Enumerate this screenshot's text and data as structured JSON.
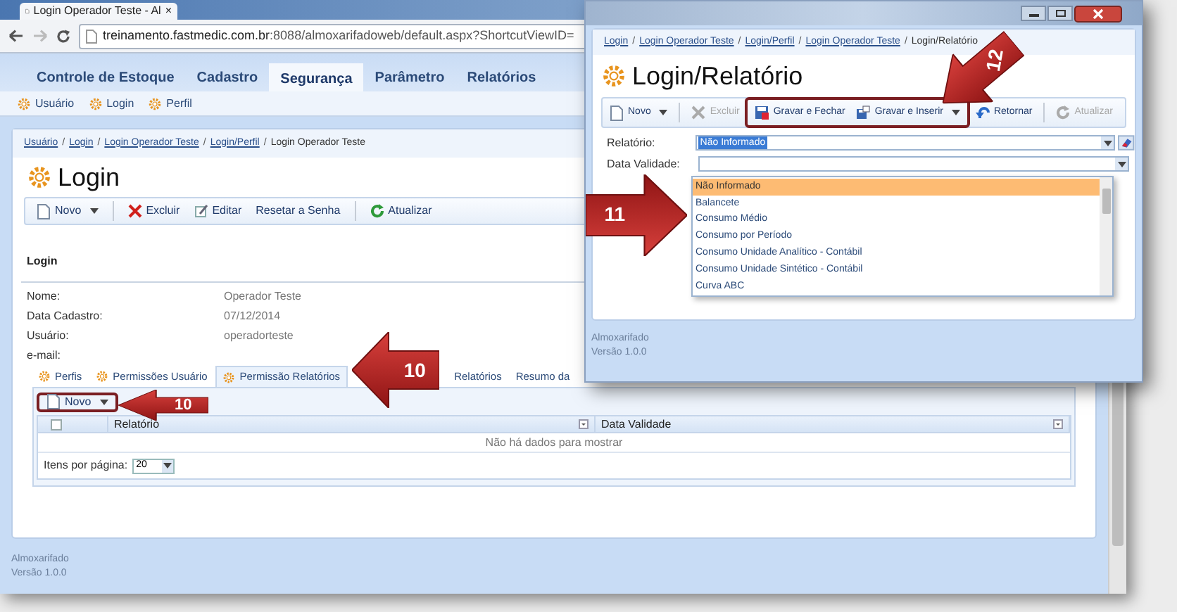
{
  "browser": {
    "tab_title": "Login Operador Teste - Al",
    "tab_close": "×",
    "url_host": "treinamento.fastmedic.com.br",
    "url_rest": ":8088/almoxarifadoweb/default.aspx?ShortcutViewID="
  },
  "menu": [
    {
      "label": "Controle de Estoque",
      "selected": false
    },
    {
      "label": "Cadastro",
      "selected": false
    },
    {
      "label": "Segurança",
      "selected": true
    },
    {
      "label": "Parâmetro",
      "selected": false
    },
    {
      "label": "Relatórios",
      "selected": false
    }
  ],
  "submenu": [
    "Usuário",
    "Login",
    "Perfil"
  ],
  "breadcrumb": {
    "separator": "/",
    "items": [
      {
        "text": "Usuário",
        "link": true
      },
      {
        "text": "Login",
        "link": true
      },
      {
        "text": "Login Operador Teste",
        "link": true
      },
      {
        "text": "Login/Perfil",
        "link": true
      },
      {
        "text": "Login Operador Teste",
        "link": false
      }
    ]
  },
  "page_title": "Login",
  "toolbar": [
    {
      "kind": "new",
      "label": "Novo",
      "dropdown": true
    },
    {
      "kind": "divider"
    },
    {
      "kind": "delete",
      "label": "Excluir"
    },
    {
      "kind": "edit",
      "label": "Editar"
    },
    {
      "kind": "text",
      "label": "Resetar a Senha"
    },
    {
      "kind": "divider"
    },
    {
      "kind": "refresh",
      "label": "Atualizar"
    }
  ],
  "section": {
    "title": "Login",
    "fields": [
      {
        "label": "Nome:",
        "value": "Operador Teste"
      },
      {
        "label": "Data Cadastro:",
        "value": "07/12/2014"
      },
      {
        "label": "Usuário:",
        "value": "operadorteste"
      },
      {
        "label": "e-mail:"
      }
    ]
  },
  "detail_tabs": [
    {
      "label": "Perfis",
      "kind": "gear",
      "selected": false
    },
    {
      "label": "Permissões Usuário",
      "kind": "gear",
      "selected": false
    },
    {
      "label": "Permissão Relatórios",
      "kind": "gear",
      "selected": true
    },
    {
      "label": "Relatórios",
      "kind": "plain",
      "selected": false
    },
    {
      "label": "Resumo da",
      "kind": "plain",
      "selected": false
    }
  ],
  "grid": {
    "new_button": {
      "label": "Novo",
      "highlighted": true
    },
    "select_all_checked": false,
    "columns": [
      "Relatório",
      "Data Validade"
    ],
    "empty": "Não há dados para mostrar",
    "paging_label": "Itens por página:",
    "page_size": "20"
  },
  "footer": {
    "app": "Almoxarifado",
    "version": "Versão 1.0.0"
  },
  "popup": {
    "breadcrumb": {
      "separator": "/",
      "items": [
        {
          "text": "Login",
          "link": true
        },
        {
          "text": "Login Operador Teste",
          "link": true
        },
        {
          "text": "Login/Perfil",
          "link": true
        },
        {
          "text": "Login Operador Teste",
          "link": true
        },
        {
          "text": "Login/Relatório",
          "link": false
        }
      ]
    },
    "title": "Login/Relatório",
    "toolbar": [
      {
        "kind": "new",
        "label": "Novo",
        "dropdown": true,
        "disabled": false,
        "highlighted": false
      },
      {
        "kind": "divider"
      },
      {
        "kind": "delete",
        "label": "Excluir",
        "disabled": true,
        "highlighted": false
      },
      {
        "kind": "save_close",
        "label": "Gravar e Fechar",
        "disabled": false,
        "highlighted": true
      },
      {
        "kind": "save_new",
        "label": "Gravar e Inserir",
        "dropdown": true,
        "disabled": false,
        "highlighted": true
      },
      {
        "kind": "back",
        "label": "Retornar",
        "disabled": false,
        "highlighted": false
      },
      {
        "kind": "divider"
      },
      {
        "kind": "refresh",
        "label": "Atualizar",
        "disabled": true,
        "highlighted": false
      }
    ],
    "report_label": "Relatório:",
    "report_value": "Não Informado",
    "date_label": "Data Validade:",
    "options": [
      {
        "label": "Não Informado",
        "selected": true
      },
      {
        "label": "Balancete",
        "selected": false
      },
      {
        "label": "Consumo Médio",
        "selected": false
      },
      {
        "label": "Consumo por Período",
        "selected": false
      },
      {
        "label": "Consumo Unidade Analítico - Contábil",
        "selected": false
      },
      {
        "label": "Consumo Unidade Sintético - Contábil",
        "selected": false
      },
      {
        "label": "Curva ABC",
        "selected": false
      }
    ],
    "footer": {
      "app": "Almoxarifado",
      "version": "Versão 1.0.0"
    }
  },
  "callouts": [
    {
      "number": "10",
      "kind": "left"
    },
    {
      "number": "10",
      "kind": "left"
    },
    {
      "number": "11",
      "kind": "right"
    },
    {
      "number": "12",
      "kind": "diagonal"
    }
  ]
}
